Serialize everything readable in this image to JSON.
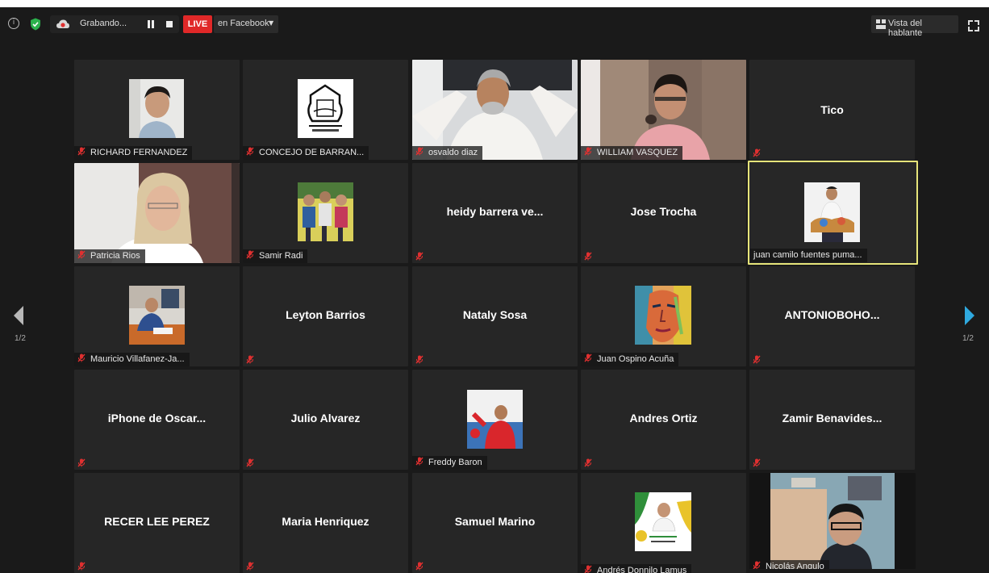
{
  "topbar": {
    "info_icon": "info-icon",
    "security_icon": "shield-check-icon",
    "recording_label": "Grabando...",
    "live_label": "LIVE",
    "stream_label": "en Facebook",
    "view_label": "Vista del hablante"
  },
  "pager": {
    "prev_page": "1/2",
    "next_page": "1/2"
  },
  "colors": {
    "live_red": "#e02828",
    "active_speaker_border": "#e6e47a",
    "muted_mic": "#e03030",
    "tile_bg": "#262626",
    "nav_arrow_right": "#2fa9df"
  },
  "participants": [
    {
      "name": "RICHARD FERNANDEZ"
    },
    {
      "name": "CONCEJO DE BARRAN..."
    },
    {
      "name": "osvaldo diaz"
    },
    {
      "name": "WILLIAM VASQUEZ"
    },
    {
      "name": "Tico"
    },
    {
      "name": "Patricia Rios"
    },
    {
      "name": "Samir Radi"
    },
    {
      "name": "heidy barrera ve..."
    },
    {
      "name": "Jose Trocha"
    },
    {
      "name": "juan camilo fuentes puma..."
    },
    {
      "name": "Mauricio Villafanez-Ja..."
    },
    {
      "name": "Leyton Barrios"
    },
    {
      "name": "Nataly Sosa"
    },
    {
      "name": "Juan Ospino Acuña"
    },
    {
      "name": "ANTONIOBOHO..."
    },
    {
      "name": "iPhone de Oscar..."
    },
    {
      "name": "Julio Alvarez"
    },
    {
      "name": "Freddy Baron"
    },
    {
      "name": "Andres Ortiz"
    },
    {
      "name": "Zamir  Benavides..."
    },
    {
      "name": "RECER LEE PEREZ"
    },
    {
      "name": "Maria Henriquez"
    },
    {
      "name": "Samuel Marino"
    },
    {
      "name": "Andrés Donnilo Lamus"
    },
    {
      "name": "Nicolás Angulo"
    }
  ]
}
